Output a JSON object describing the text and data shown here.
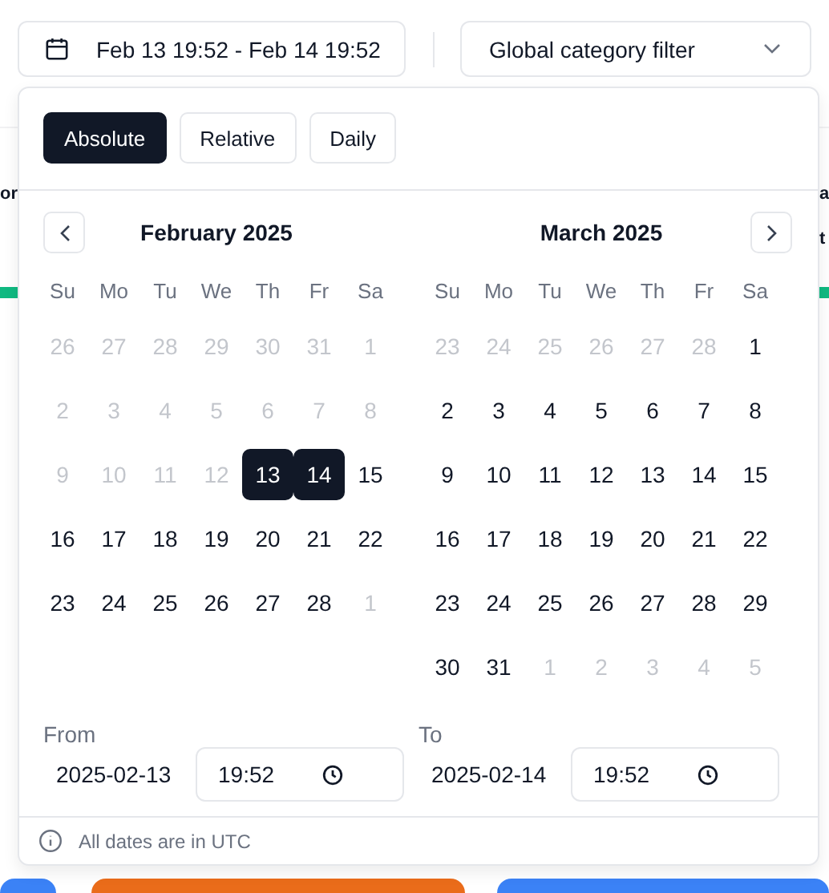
{
  "date_range_button": {
    "label": "Feb 13 19:52 - Feb 14 19:52"
  },
  "category_filter": {
    "label": "Global category filter"
  },
  "background": {
    "left_text": "or",
    "right_lines": [
      "a",
      "t"
    ]
  },
  "picker": {
    "modes": [
      {
        "label": "Absolute",
        "selected": true
      },
      {
        "label": "Relative",
        "selected": false
      },
      {
        "label": "Daily",
        "selected": false
      }
    ],
    "months": [
      {
        "title": "February 2025",
        "weekdays": [
          "Su",
          "Mo",
          "Tu",
          "We",
          "Th",
          "Fr",
          "Sa"
        ],
        "weeks": [
          [
            {
              "label": "26",
              "muted": true,
              "selected": false
            },
            {
              "label": "27",
              "muted": true,
              "selected": false
            },
            {
              "label": "28",
              "muted": true,
              "selected": false
            },
            {
              "label": "29",
              "muted": true,
              "selected": false
            },
            {
              "label": "30",
              "muted": true,
              "selected": false
            },
            {
              "label": "31",
              "muted": true,
              "selected": false
            },
            {
              "label": "1",
              "muted": true,
              "selected": false
            }
          ],
          [
            {
              "label": "2",
              "muted": true,
              "selected": false
            },
            {
              "label": "3",
              "muted": true,
              "selected": false
            },
            {
              "label": "4",
              "muted": true,
              "selected": false
            },
            {
              "label": "5",
              "muted": true,
              "selected": false
            },
            {
              "label": "6",
              "muted": true,
              "selected": false
            },
            {
              "label": "7",
              "muted": true,
              "selected": false
            },
            {
              "label": "8",
              "muted": true,
              "selected": false
            }
          ],
          [
            {
              "label": "9",
              "muted": true,
              "selected": false
            },
            {
              "label": "10",
              "muted": true,
              "selected": false
            },
            {
              "label": "11",
              "muted": true,
              "selected": false
            },
            {
              "label": "12",
              "muted": true,
              "selected": false
            },
            {
              "label": "13",
              "muted": false,
              "selected": true
            },
            {
              "label": "14",
              "muted": false,
              "selected": true
            },
            {
              "label": "15",
              "muted": false,
              "selected": false
            }
          ],
          [
            {
              "label": "16",
              "muted": false,
              "selected": false
            },
            {
              "label": "17",
              "muted": false,
              "selected": false
            },
            {
              "label": "18",
              "muted": false,
              "selected": false
            },
            {
              "label": "19",
              "muted": false,
              "selected": false
            },
            {
              "label": "20",
              "muted": false,
              "selected": false
            },
            {
              "label": "21",
              "muted": false,
              "selected": false
            },
            {
              "label": "22",
              "muted": false,
              "selected": false
            }
          ],
          [
            {
              "label": "23",
              "muted": false,
              "selected": false
            },
            {
              "label": "24",
              "muted": false,
              "selected": false
            },
            {
              "label": "25",
              "muted": false,
              "selected": false
            },
            {
              "label": "26",
              "muted": false,
              "selected": false
            },
            {
              "label": "27",
              "muted": false,
              "selected": false
            },
            {
              "label": "28",
              "muted": false,
              "selected": false
            },
            {
              "label": "1",
              "muted": true,
              "selected": false
            }
          ]
        ]
      },
      {
        "title": "March 2025",
        "weekdays": [
          "Su",
          "Mo",
          "Tu",
          "We",
          "Th",
          "Fr",
          "Sa"
        ],
        "weeks": [
          [
            {
              "label": "23",
              "muted": true,
              "selected": false
            },
            {
              "label": "24",
              "muted": true,
              "selected": false
            },
            {
              "label": "25",
              "muted": true,
              "selected": false
            },
            {
              "label": "26",
              "muted": true,
              "selected": false
            },
            {
              "label": "27",
              "muted": true,
              "selected": false
            },
            {
              "label": "28",
              "muted": true,
              "selected": false
            },
            {
              "label": "1",
              "muted": false,
              "selected": false
            }
          ],
          [
            {
              "label": "2",
              "muted": false,
              "selected": false
            },
            {
              "label": "3",
              "muted": false,
              "selected": false
            },
            {
              "label": "4",
              "muted": false,
              "selected": false
            },
            {
              "label": "5",
              "muted": false,
              "selected": false
            },
            {
              "label": "6",
              "muted": false,
              "selected": false
            },
            {
              "label": "7",
              "muted": false,
              "selected": false
            },
            {
              "label": "8",
              "muted": false,
              "selected": false
            }
          ],
          [
            {
              "label": "9",
              "muted": false,
              "selected": false
            },
            {
              "label": "10",
              "muted": false,
              "selected": false
            },
            {
              "label": "11",
              "muted": false,
              "selected": false
            },
            {
              "label": "12",
              "muted": false,
              "selected": false
            },
            {
              "label": "13",
              "muted": false,
              "selected": false
            },
            {
              "label": "14",
              "muted": false,
              "selected": false
            },
            {
              "label": "15",
              "muted": false,
              "selected": false
            }
          ],
          [
            {
              "label": "16",
              "muted": false,
              "selected": false
            },
            {
              "label": "17",
              "muted": false,
              "selected": false
            },
            {
              "label": "18",
              "muted": false,
              "selected": false
            },
            {
              "label": "19",
              "muted": false,
              "selected": false
            },
            {
              "label": "20",
              "muted": false,
              "selected": false
            },
            {
              "label": "21",
              "muted": false,
              "selected": false
            },
            {
              "label": "22",
              "muted": false,
              "selected": false
            }
          ],
          [
            {
              "label": "23",
              "muted": false,
              "selected": false
            },
            {
              "label": "24",
              "muted": false,
              "selected": false
            },
            {
              "label": "25",
              "muted": false,
              "selected": false
            },
            {
              "label": "26",
              "muted": false,
              "selected": false
            },
            {
              "label": "27",
              "muted": false,
              "selected": false
            },
            {
              "label": "28",
              "muted": false,
              "selected": false
            },
            {
              "label": "29",
              "muted": false,
              "selected": false
            }
          ],
          [
            {
              "label": "30",
              "muted": false,
              "selected": false
            },
            {
              "label": "31",
              "muted": false,
              "selected": false
            },
            {
              "label": "1",
              "muted": true,
              "selected": false
            },
            {
              "label": "2",
              "muted": true,
              "selected": false
            },
            {
              "label": "3",
              "muted": true,
              "selected": false
            },
            {
              "label": "4",
              "muted": true,
              "selected": false
            },
            {
              "label": "5",
              "muted": true,
              "selected": false
            }
          ]
        ]
      }
    ],
    "from": {
      "label": "From",
      "date": "2025-02-13",
      "time": "19:52"
    },
    "to": {
      "label": "To",
      "date": "2025-02-14",
      "time": "19:52"
    },
    "note": "All dates are in UTC"
  }
}
